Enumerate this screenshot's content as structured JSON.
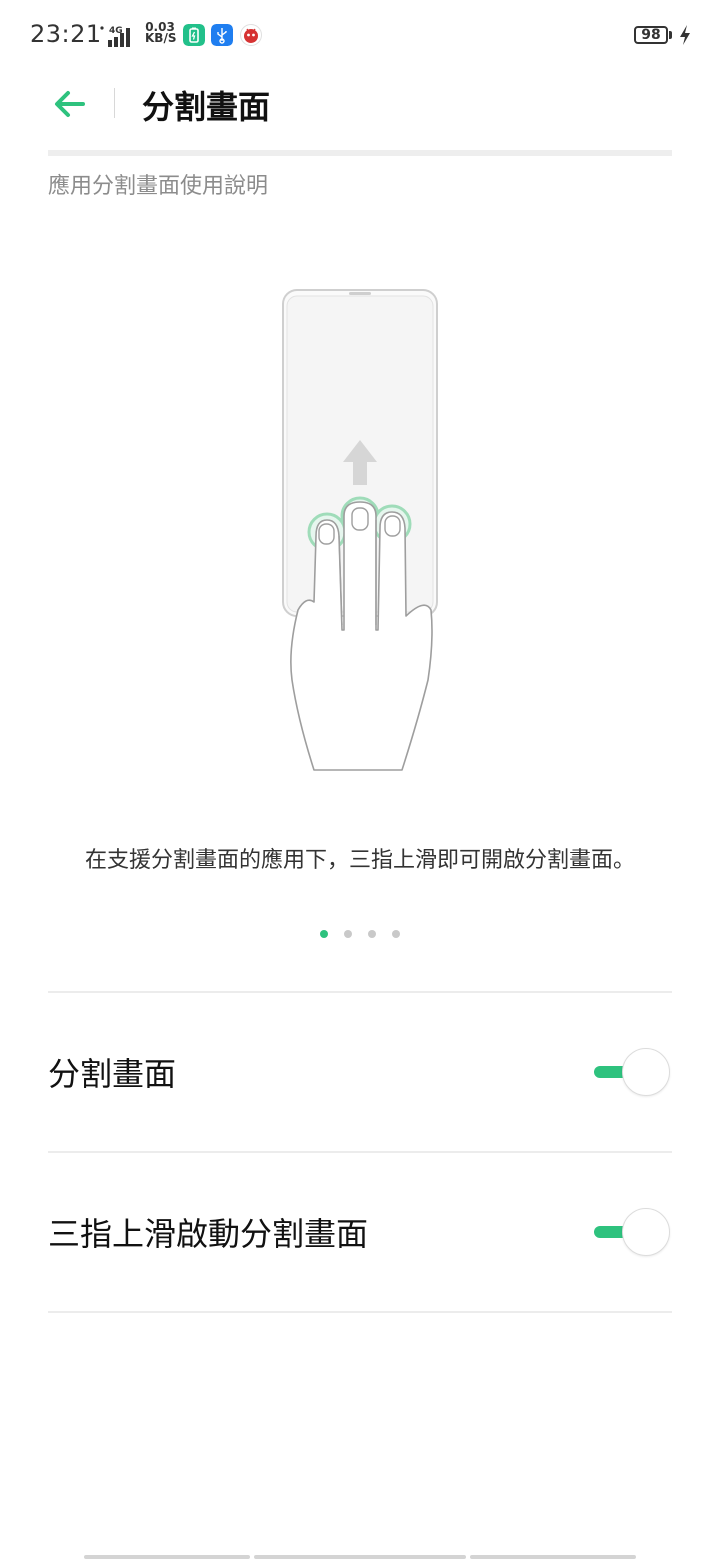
{
  "status_bar": {
    "time": "23:21",
    "net_speed_value": "0.03",
    "net_speed_unit": "KB/S",
    "battery_level": "98",
    "icons": [
      "signal-4g-icon",
      "battery-saver-app-icon",
      "usb-icon",
      "antutu-app-icon",
      "charging-bolt-icon"
    ]
  },
  "header": {
    "title": "分割畫面",
    "back_icon": "arrow-left-icon"
  },
  "section": {
    "caption": "應用分割畫面使用說明"
  },
  "guide": {
    "text": "在支援分割畫面的應用下，三指上滑即可開啟分割畫面。",
    "illustration": "three-finger-swipe-up-illustration",
    "pages": 4,
    "current_page": 1
  },
  "settings": [
    {
      "label": "分割畫面",
      "enabled": true
    },
    {
      "label": "三指上滑啟動分割畫面",
      "enabled": true
    }
  ],
  "colors": {
    "accent": "#2ec27e",
    "text_primary": "#111111",
    "text_secondary": "#8c8c8c",
    "divider": "#ececec"
  }
}
